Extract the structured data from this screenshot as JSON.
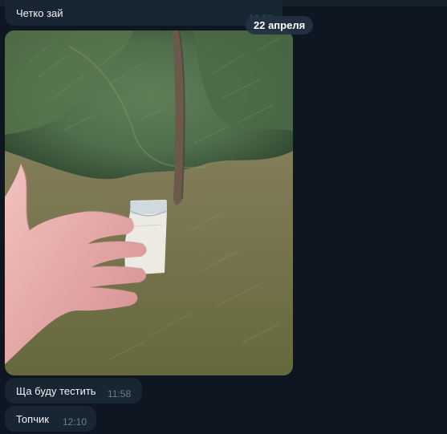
{
  "date_separator": "22 апреля",
  "messages": [
    {
      "text": "Четко зай",
      "time": "12:59"
    },
    {
      "type": "photo",
      "description": "Hand holding a small plastic bag near a pine tree"
    },
    {
      "text": "Ща буду тестить",
      "time": "11:58"
    },
    {
      "text": "Топчик",
      "time": "12:10"
    }
  ],
  "colors": {
    "background": "#0e1621",
    "bubble": "#182533",
    "time_text": "#6d7f8f",
    "text": "#f5f5f5"
  }
}
